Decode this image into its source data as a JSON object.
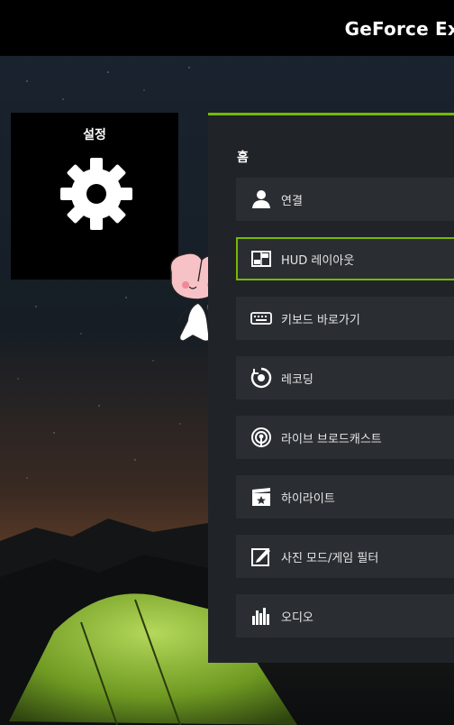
{
  "header": {
    "brand": "GeForce Ex"
  },
  "settings_tile": {
    "title": "설정"
  },
  "panel": {
    "title": "홈",
    "items": [
      {
        "label": "연결",
        "icon": "person-icon"
      },
      {
        "label": "HUD 레이아웃",
        "icon": "hud-layout-icon",
        "selected": true
      },
      {
        "label": "키보드 바로가기",
        "icon": "keyboard-icon"
      },
      {
        "label": "레코딩",
        "icon": "record-icon"
      },
      {
        "label": "라이브 브로드캐스트",
        "icon": "broadcast-icon"
      },
      {
        "label": "하이라이트",
        "icon": "highlight-icon"
      },
      {
        "label": "사진 모드/게임 필터",
        "icon": "photo-filter-icon"
      },
      {
        "label": "오디오",
        "icon": "audio-icon"
      }
    ]
  },
  "colors": {
    "accent": "#76b900",
    "panel": "#202428",
    "item": "#2a2e33"
  }
}
